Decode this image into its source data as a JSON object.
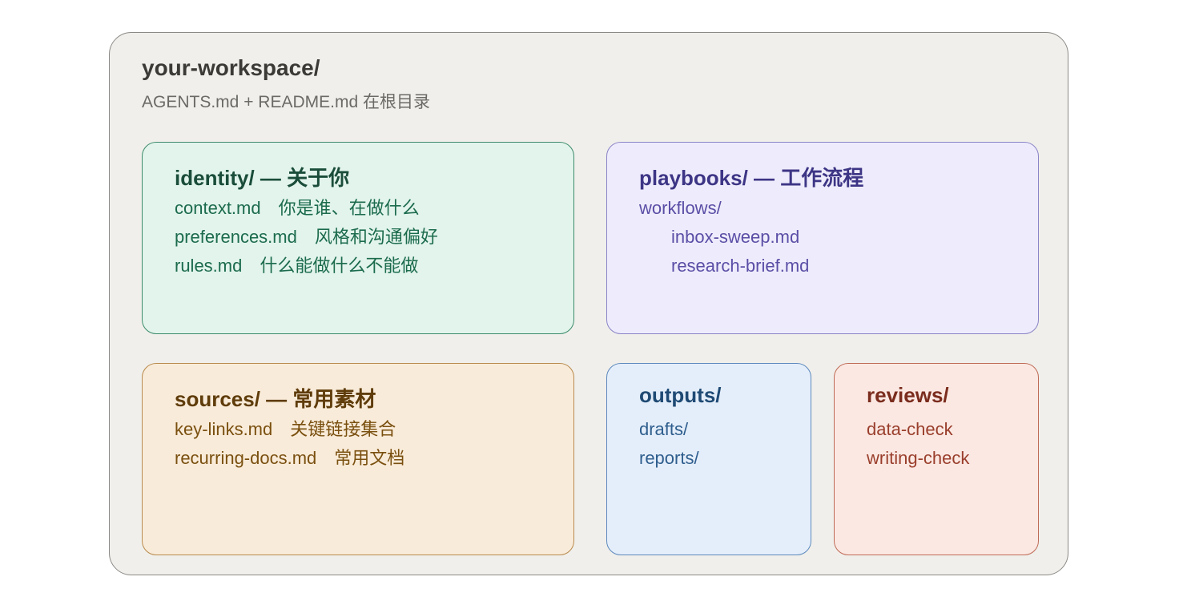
{
  "workspace": {
    "title": "your-workspace/",
    "subtitle": "AGENTS.md + README.md 在根目录"
  },
  "identity": {
    "title": "identity/ — 关于你",
    "items": [
      {
        "file": "context.md",
        "desc": "你是谁、在做什么"
      },
      {
        "file": "preferences.md",
        "desc": "风格和沟通偏好"
      },
      {
        "file": "rules.md",
        "desc": "什么能做什么不能做"
      }
    ]
  },
  "playbooks": {
    "title": "playbooks/ — 工作流程",
    "folder": "workflows/",
    "items": [
      "inbox-sweep.md",
      "research-brief.md"
    ]
  },
  "sources": {
    "title": "sources/ — 常用素材",
    "items": [
      {
        "file": "key-links.md",
        "desc": "关键链接集合"
      },
      {
        "file": "recurring-docs.md",
        "desc": "常用文档"
      }
    ]
  },
  "outputs": {
    "title": "outputs/",
    "items": [
      "drafts/",
      "reports/"
    ]
  },
  "reviews": {
    "title": "reviews/",
    "items": [
      "data-check",
      "writing-check"
    ]
  },
  "colors": {
    "identity": "#e2f4ec",
    "playbooks": "#eeecfc",
    "sources": "#f9ebd9",
    "outputs": "#e4eefa",
    "reviews": "#fbe8e2",
    "workspace": "#f0efeb"
  }
}
